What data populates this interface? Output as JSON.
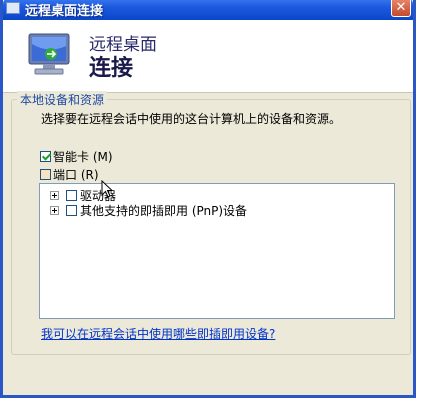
{
  "window": {
    "title": "远程桌面连接"
  },
  "header": {
    "line1": "远程桌面",
    "line2": "连接"
  },
  "local_resources": {
    "group_title": "本地设备和资源",
    "description": "选择要在远程会话中使用的这台计算机上的设备和资源。",
    "smart_card": {
      "label": "智能卡 (M)",
      "checked": true
    },
    "ports": {
      "label": "端口 (R)",
      "checked": false
    },
    "tree": [
      {
        "label": "驱动器",
        "checked": false
      },
      {
        "label": "其他支持的即插即用 (PnP)设备",
        "checked": false
      }
    ],
    "help_link": "我可以在远程会话中使用哪些即插即用设备?"
  },
  "colors": {
    "titlebar": "#0a46c8",
    "link": "#0033cc",
    "dialog_bg": "#ece9d8"
  }
}
